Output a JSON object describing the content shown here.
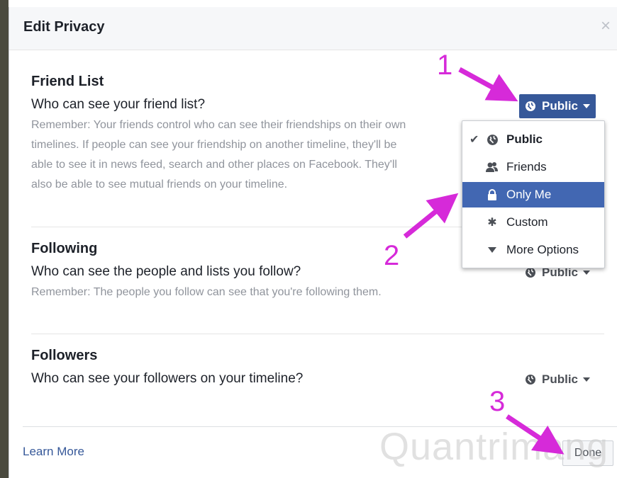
{
  "dialog": {
    "title": "Edit Privacy",
    "close_glyph": "×"
  },
  "sections": [
    {
      "title": "Friend List",
      "question": "Who can see your friend list?",
      "note": "Remember: Your friends control who can see their friendships on their own timelines. If people can see your friendship on another timeline, they'll be able to see it in news feed, search and other places on Facebook. They'll also be able to see mutual friends on your timeline.",
      "audience": "Public"
    },
    {
      "title": "Following",
      "question": "Who can see the people and lists you follow?",
      "note": "Remember: The people you follow can see that you're following them.",
      "audience": "Public"
    },
    {
      "title": "Followers",
      "question": "Who can see your followers on your timeline?",
      "audience": "Public"
    }
  ],
  "menu": {
    "items": [
      {
        "label": "Public",
        "icon": "globe-icon",
        "checked": true
      },
      {
        "label": "Friends",
        "icon": "friends-icon"
      },
      {
        "label": "Only Me",
        "icon": "lock-icon",
        "selected": true
      },
      {
        "label": "Custom",
        "icon": "gear-icon"
      },
      {
        "label": "More Options",
        "icon": "triangle-down-icon"
      }
    ]
  },
  "footer": {
    "learn_more": "Learn More",
    "done": "Done"
  },
  "annotations": [
    "1",
    "2",
    "3"
  ],
  "watermark": "Quantrimang",
  "colors": {
    "accent": "#365899",
    "menu_selected": "#4267b2",
    "annotation": "#d62ad9"
  }
}
